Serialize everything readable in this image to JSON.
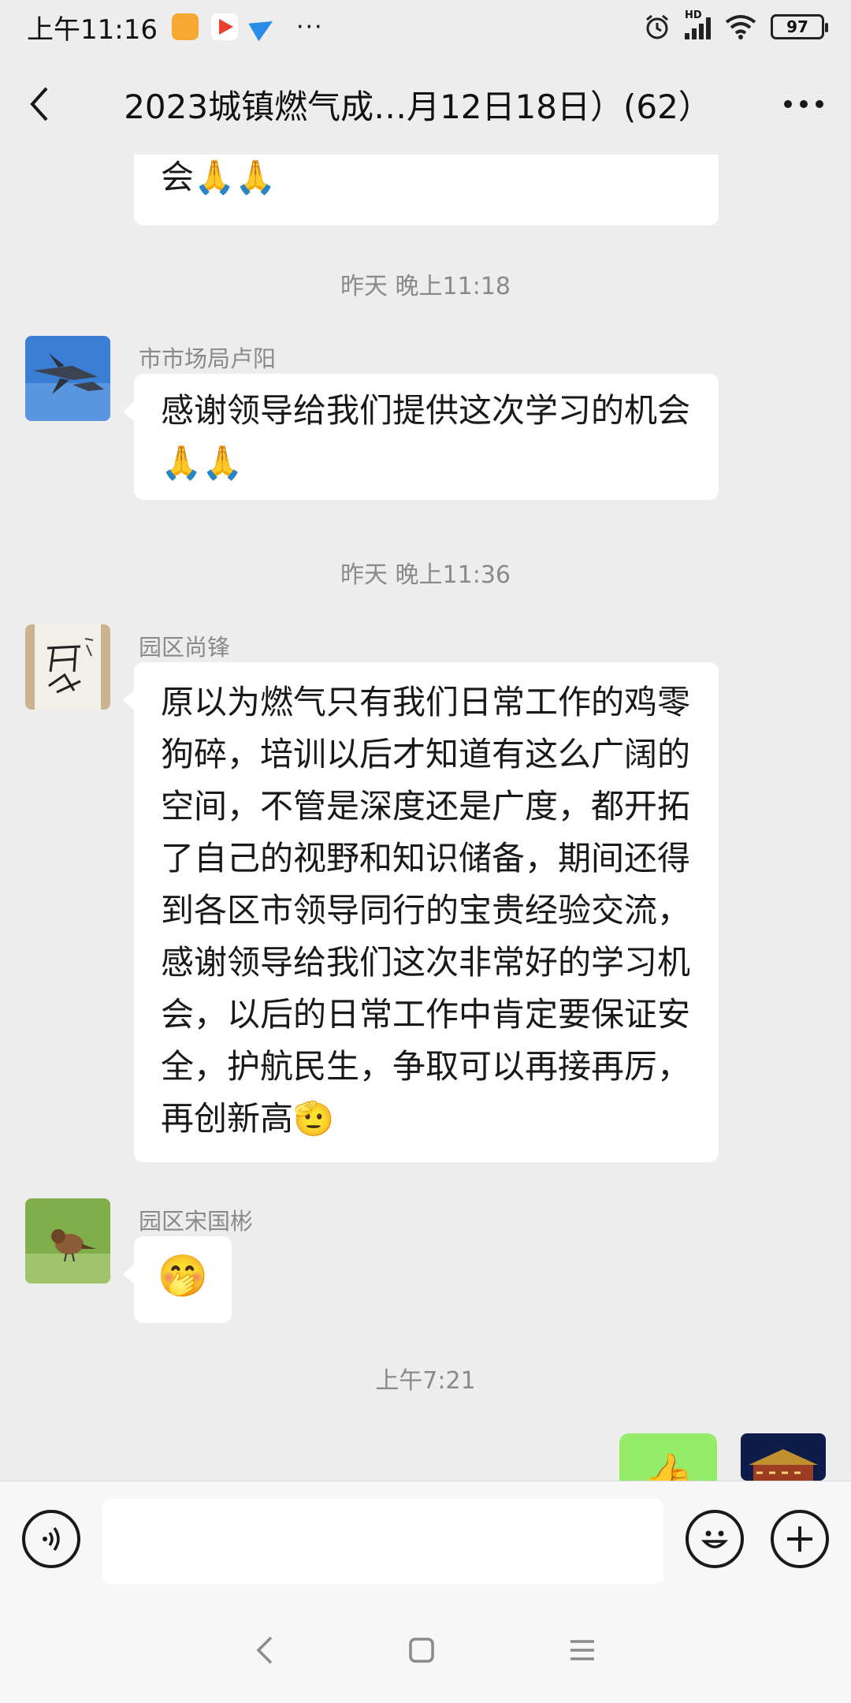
{
  "status_bar": {
    "time": "上午11:16",
    "dots": "···",
    "network": "HD",
    "battery": "97"
  },
  "header": {
    "title": "2023城镇燃气成…月12日18日）(62）"
  },
  "messages": [
    {
      "kind": "partial",
      "text": "会🙏🙏"
    },
    {
      "kind": "time",
      "text": "昨天 晚上11:18"
    },
    {
      "kind": "msg",
      "sender": "市市场局卢阳",
      "text": "感谢领导给我们提供这次学习的机会🙏🙏"
    },
    {
      "kind": "time",
      "text": "昨天 晚上11:36"
    },
    {
      "kind": "msg",
      "sender": "园区尚锋",
      "text": "原以为燃气只有我们日常工作的鸡零狗碎，培训以后才知道有这么广阔的空间，不管是深度还是广度，都开拓了自己的视野和知识储备，期间还得到各区市领导同行的宝贵经验交流，感谢领导给我们这次非常好的学习机会，以后的日常工作中肯定要保证安全，护航民生，争取可以再接再厉，再创新高🫡"
    },
    {
      "kind": "msg",
      "sender": "园区宋国彬",
      "text": "🤭"
    },
    {
      "kind": "time",
      "text": "上午7:21"
    },
    {
      "kind": "self",
      "text": "👍"
    }
  ],
  "input": {
    "placeholder": ""
  },
  "icons": {
    "back": "chevron-left-icon",
    "more": "more-horizontal-icon",
    "voice": "voice-icon",
    "emoji": "emoji-icon",
    "plus": "plus-icon",
    "nav_back": "nav-back-icon",
    "nav_home": "nav-home-icon",
    "nav_menu": "nav-menu-icon"
  },
  "colors": {
    "background": "#ededed",
    "bubble_in": "#ffffff",
    "bubble_out": "#95ec69",
    "meta_text": "#8a8a8a"
  }
}
